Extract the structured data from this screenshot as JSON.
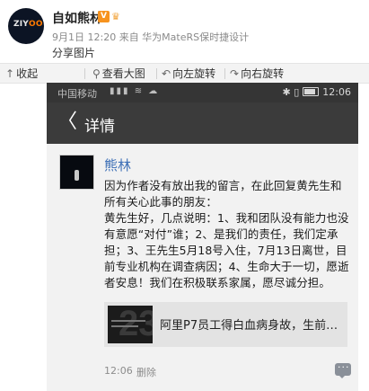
{
  "post": {
    "author": "自如熊林",
    "vip_badge": "V",
    "crown_badge": "♛",
    "meta": "9月1日 12:20 来自 华为MateRS保时捷设计",
    "share_label": "分享图片",
    "avatar_text_a": "ZIY",
    "avatar_text_b": "OO"
  },
  "toolbar": {
    "collapse": "收起",
    "view_large": "查看大图",
    "rotate_left": "向左旋转",
    "rotate_right": "向右旋转",
    "collapse_icon": "↑",
    "view_icon": "⚲",
    "rotate_left_icon": "↶",
    "rotate_right_icon": "↷"
  },
  "phone": {
    "carrier": "中国移动",
    "status_icons": "▮▮▮ ≋ ☁",
    "bt_icons": "✱ ▯",
    "time": "12:06",
    "back": "〈",
    "title": "详情"
  },
  "comment": {
    "name": "熊林",
    "body": "因为作者没有放出我的留言，在此回复黄先生和所有关心此事的朋友：\n黄先生好，几点说明：1、我和团队没有能力也没有意愿“对付”谁；2、是我们的责任，我们定承担；3、王先生5月18号入住，7月13日离世，目前专业机构在调查病因；4、生命大于一切，愿逝者安息！我们在积极联系家属，愿尽诚分担。",
    "link_title": "阿里P7员工得白血病身故，生前…",
    "thumb_number": "23",
    "time": "12:06",
    "delete": "删除"
  }
}
